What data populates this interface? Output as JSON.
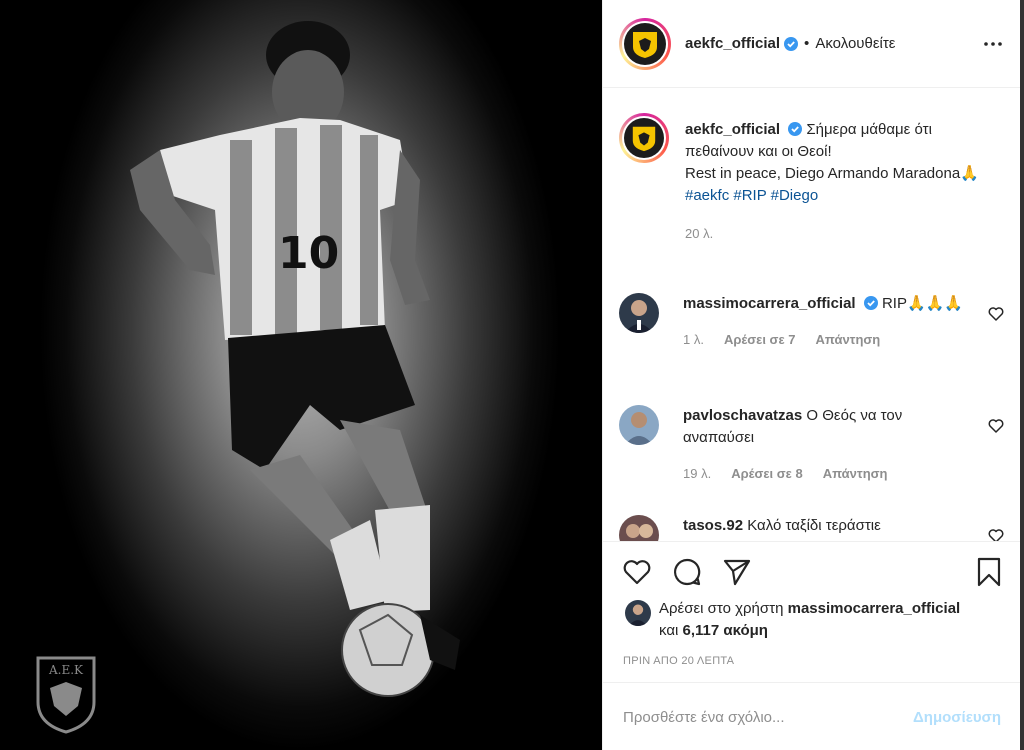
{
  "post": {
    "username": "aekfc_official",
    "separator": "•",
    "follow_label": "Ακολουθείτε"
  },
  "caption": {
    "username": "aekfc_official",
    "line1": "Σήμερα μάθαμε ότι πεθαίνουν και οι Θεοί!",
    "line2": "Rest in peace, Diego Armando Maradona🙏",
    "hashtags": [
      "#aekfc",
      "#RIP",
      "#Diego"
    ],
    "time": "20 λ."
  },
  "comments": [
    {
      "username": "massimocarrera_official",
      "text": "RIP🙏🙏🙏",
      "time": "1 λ.",
      "likes": "Αρέσει σε 7",
      "reply": "Απάντηση"
    },
    {
      "username": "pavloschavatzas",
      "text": "Ο Θεός να τον αναπαύσει",
      "time": "19 λ.",
      "likes": "Αρέσει σε 8",
      "reply": "Απάντηση"
    },
    {
      "username": "tasos.92",
      "text": "Καλό ταξίδι τεράστιε"
    }
  ],
  "likes": {
    "prefix": "Αρέσει στο χρήστη",
    "username": "massimocarrera_official",
    "suffix_and": "και",
    "count": "6,117 ακόμη"
  },
  "posted_time": "ΠΡΙΝ ΑΠΟ 20 ΛΕΠΤΑ",
  "comment_input": {
    "placeholder": "Προσθέστε ένα σχόλιο...",
    "post_label": "Δημοσίευση"
  },
  "colors": {
    "link": "#00376b",
    "verified": "#3897f0",
    "post_disabled": "#b2dffc"
  }
}
